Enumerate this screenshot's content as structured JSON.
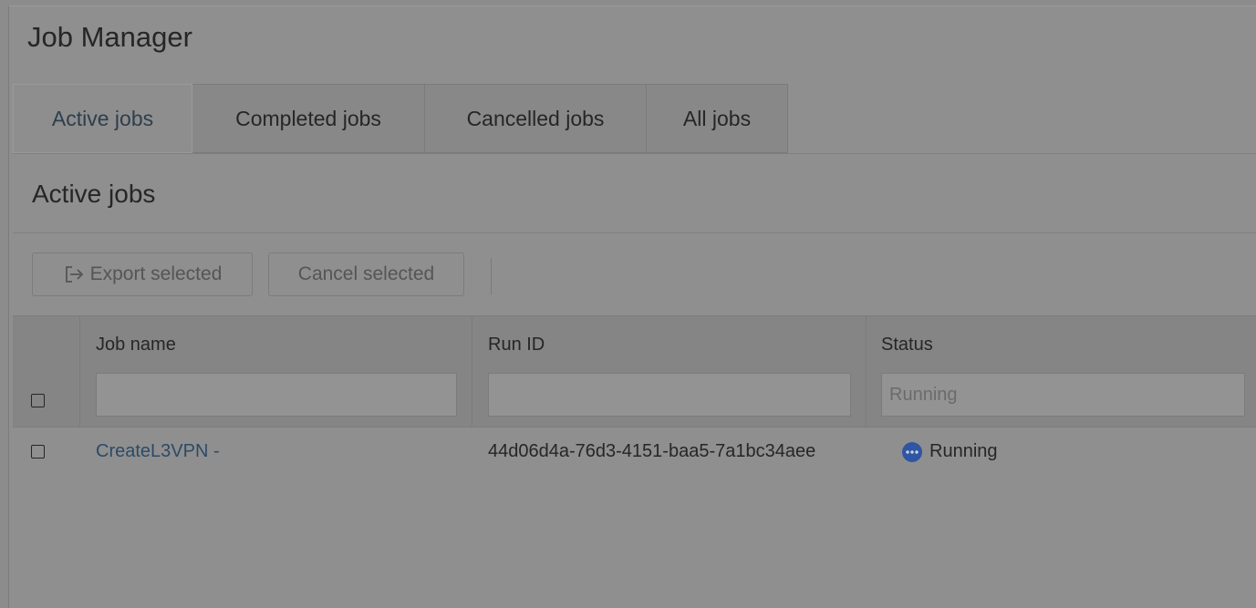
{
  "app": {
    "title": "Job Manager"
  },
  "tabs": [
    {
      "label": "Active jobs",
      "active": true
    },
    {
      "label": "Completed jobs",
      "active": false
    },
    {
      "label": "Cancelled jobs",
      "active": false
    },
    {
      "label": "All jobs",
      "active": false
    }
  ],
  "section": {
    "title": "Active jobs"
  },
  "toolbar": {
    "export_label": "Export selected",
    "export_icon": "export-icon",
    "cancel_label": "Cancel selected"
  },
  "table": {
    "columns": [
      {
        "label": "Job name",
        "filter_value": "",
        "filter_placeholder": ""
      },
      {
        "label": "Run ID",
        "filter_value": "",
        "filter_placeholder": ""
      },
      {
        "label": "Status",
        "filter_value": "",
        "filter_placeholder": "Running"
      }
    ],
    "rows": [
      {
        "job_name": "CreateL3VPN -",
        "run_id": "44d06d4a-76d3-4151-baa5-7a1bc34aee",
        "status": "Running",
        "status_icon": "running-dots-icon"
      }
    ]
  },
  "colors": {
    "overlay": "#8c8c8c",
    "link": "#2c4a66",
    "status_running": "#2f55a3"
  }
}
